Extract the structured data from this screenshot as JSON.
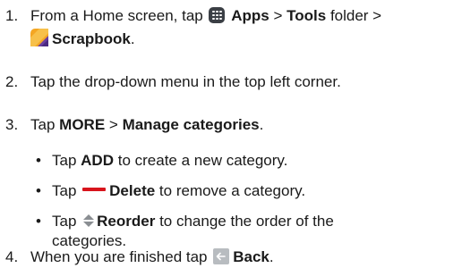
{
  "steps": [
    {
      "number": "1.",
      "line1": {
        "pre": "From a Home screen, tap",
        "apps": "Apps",
        "sep1": ">",
        "tools": "Tools",
        "folder": "folder >"
      },
      "line2": {
        "scrapbook": "Scrapbook",
        "end": "."
      },
      "icons": {
        "apps": "apps-grid-icon",
        "scrapbook": "scrapbook-app-icon"
      }
    },
    {
      "number": "2.",
      "text": "Tap the drop-down menu in the top left corner."
    },
    {
      "number": "3.",
      "pre": "Tap",
      "more": "MORE",
      "sep": ">",
      "manage": "Manage categories",
      "end": ".",
      "bullets": [
        {
          "dot": "•",
          "pre": "Tap",
          "bold": "ADD",
          "post": "to create a new category."
        },
        {
          "dot": "•",
          "pre": "Tap",
          "icon": "minus-icon",
          "bold": "Delete",
          "post": "to remove a category."
        },
        {
          "dot": "•",
          "pre": "Tap",
          "icon": "reorder-icon",
          "bold": "Reorder",
          "post": "to change the order of the",
          "post2": "categories."
        }
      ]
    },
    {
      "number": "4.",
      "pre": "When you are finished tap",
      "icon": "back-arrow-icon",
      "bold": "Back",
      "end": "."
    }
  ],
  "colors": {
    "text": "#1a1a1a",
    "delete_red": "#d8141c",
    "back_gray": "#b8bcc0",
    "apps_dark": "#3b3f45",
    "scrapbook_orange": "#f4a623",
    "scrapbook_purple": "#6b3fa0"
  }
}
